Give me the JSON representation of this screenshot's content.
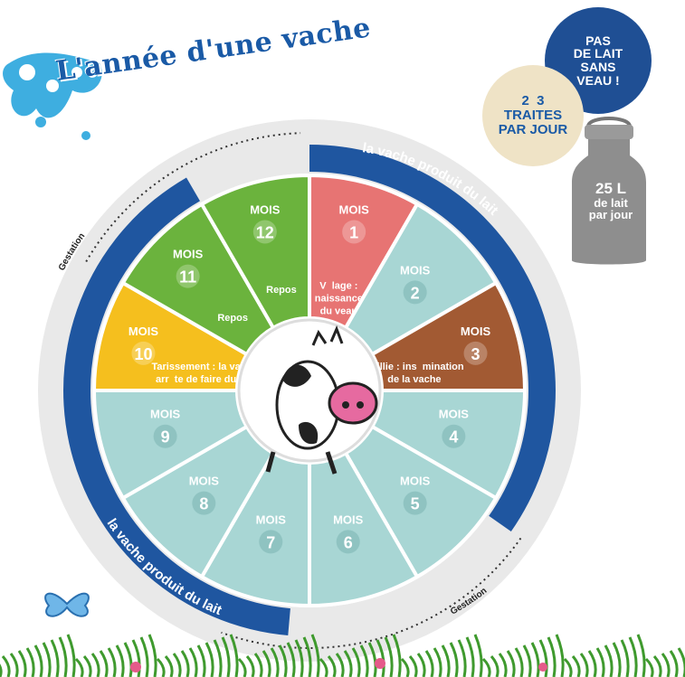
{
  "title": "L'année d'une vache",
  "badges": {
    "no_milk": [
      "PAS",
      "DE LAIT",
      "SANS",
      "VEAU !"
    ],
    "milkings": [
      "2  3",
      "TRAITES",
      "PAR JOUR"
    ],
    "can": {
      "amount": "25 L",
      "line1": "de lait",
      "line2": "par jour"
    }
  },
  "ring": {
    "top_label": "la vache produit du lait",
    "bottom_label": "la vache produit du lait",
    "gestation_label": "Gestation"
  },
  "months": [
    {
      "label": "MOIS",
      "number": "1",
      "desc": [
        "V  lage :",
        "naissance",
        "du veau"
      ],
      "color": "#e77473"
    },
    {
      "label": "MOIS",
      "number": "2",
      "desc": [],
      "color": "#a8d6d4"
    },
    {
      "label": "MOIS",
      "number": "3",
      "desc": [
        "Saillie : ins  mination",
        "de la vache"
      ],
      "color": "#a25a33"
    },
    {
      "label": "MOIS",
      "number": "4",
      "desc": [],
      "color": "#a8d6d4"
    },
    {
      "label": "MOIS",
      "number": "5",
      "desc": [],
      "color": "#a8d6d4"
    },
    {
      "label": "MOIS",
      "number": "6",
      "desc": [],
      "color": "#a8d6d4"
    },
    {
      "label": "MOIS",
      "number": "7",
      "desc": [],
      "color": "#a8d6d4"
    },
    {
      "label": "MOIS",
      "number": "8",
      "desc": [],
      "color": "#a8d6d4"
    },
    {
      "label": "MOIS",
      "number": "9",
      "desc": [],
      "color": "#a8d6d4"
    },
    {
      "label": "MOIS",
      "number": "10",
      "desc": [
        "Tarissement : la vache",
        "arr  te de faire du lait"
      ],
      "color": "#f5bf1e"
    },
    {
      "label": "MOIS",
      "number": "11",
      "desc": [
        "Repos"
      ],
      "color": "#6bb33d"
    },
    {
      "label": "MOIS",
      "number": "12",
      "desc": [
        "Repos"
      ],
      "color": "#6bb33d"
    }
  ],
  "colors": {
    "ring_blue": "#1f56a0",
    "ring_grey": "#e6e6e6",
    "cream": "#efe3c6",
    "can_grey": "#8e8e8e"
  }
}
